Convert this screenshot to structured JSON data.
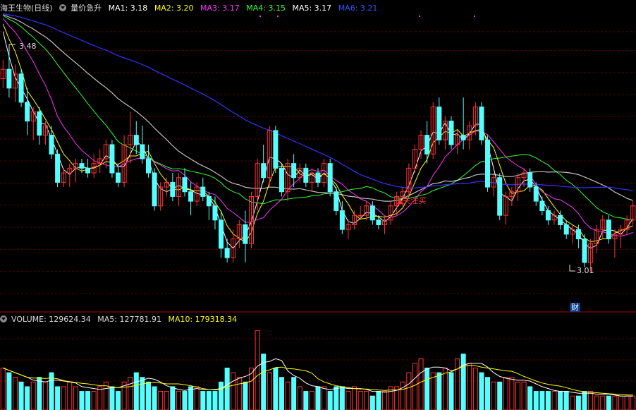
{
  "price_panel": {
    "stock_name": "海王生物(日线)",
    "indicator_name": "量价急升",
    "ma": [
      {
        "label": "MA1: 3.18",
        "color": "#ffffff"
      },
      {
        "label": "MA2: 3.20",
        "color": "#ffff00"
      },
      {
        "label": "MA3: 3.17",
        "color": "#ff33ff"
      },
      {
        "label": "MA4: 3.15",
        "color": "#33ff33"
      },
      {
        "label": "MA5: 3.17",
        "color": "#ffffff"
      },
      {
        "label": "MA6: 3.21",
        "color": "#3333ff"
      }
    ],
    "high_label": "3.48",
    "low_label": "3.01",
    "signal_text": "▲关注买",
    "finance_badge": "财"
  },
  "volume_panel": {
    "title": "VOLUME: 129624.34",
    "ma5": "MA5: 127781.91",
    "ma10": "MA10: 179318.34"
  },
  "chart_data": {
    "type": "candlestick",
    "up_color": "#ff3232",
    "down_color": "#54ffff",
    "price_range": [
      2.94,
      3.56
    ],
    "candles": [
      [
        3.42,
        3.46,
        3.4,
        3.44
      ],
      [
        3.44,
        3.48,
        3.38,
        3.4
      ],
      [
        3.4,
        3.45,
        3.37,
        3.43
      ],
      [
        3.43,
        3.44,
        3.36,
        3.37
      ],
      [
        3.37,
        3.4,
        3.3,
        3.33
      ],
      [
        3.33,
        3.36,
        3.29,
        3.35
      ],
      [
        3.35,
        3.36,
        3.28,
        3.3
      ],
      [
        3.3,
        3.33,
        3.28,
        3.32
      ],
      [
        3.3,
        3.32,
        3.25,
        3.26
      ],
      [
        3.26,
        3.27,
        3.19,
        3.2
      ],
      [
        3.2,
        3.23,
        3.19,
        3.22
      ],
      [
        3.22,
        3.24,
        3.19,
        3.23
      ],
      [
        3.23,
        3.25,
        3.2,
        3.24
      ],
      [
        3.24,
        3.25,
        3.22,
        3.23
      ],
      [
        3.23,
        3.25,
        3.21,
        3.22
      ],
      [
        3.22,
        3.26,
        3.21,
        3.24
      ],
      [
        3.24,
        3.27,
        3.22,
        3.25
      ],
      [
        3.25,
        3.29,
        3.23,
        3.28
      ],
      [
        3.28,
        3.29,
        3.21,
        3.22
      ],
      [
        3.22,
        3.24,
        3.19,
        3.2
      ],
      [
        3.2,
        3.3,
        3.19,
        3.28
      ],
      [
        3.28,
        3.35,
        3.24,
        3.3
      ],
      [
        3.3,
        3.33,
        3.26,
        3.28
      ],
      [
        3.28,
        3.32,
        3.24,
        3.25
      ],
      [
        3.25,
        3.28,
        3.21,
        3.22
      ],
      [
        3.22,
        3.23,
        3.14,
        3.15
      ],
      [
        3.15,
        3.2,
        3.14,
        3.19
      ],
      [
        3.19,
        3.21,
        3.17,
        3.2
      ],
      [
        3.2,
        3.22,
        3.16,
        3.17
      ],
      [
        3.17,
        3.22,
        3.15,
        3.21
      ],
      [
        3.21,
        3.23,
        3.17,
        3.18
      ],
      [
        3.18,
        3.2,
        3.13,
        3.16
      ],
      [
        3.16,
        3.2,
        3.15,
        3.19
      ],
      [
        3.19,
        3.21,
        3.16,
        3.17
      ],
      [
        3.17,
        3.18,
        3.12,
        3.15
      ],
      [
        3.15,
        3.17,
        3.1,
        3.12
      ],
      [
        3.12,
        3.14,
        3.04,
        3.06
      ],
      [
        3.06,
        3.08,
        3.03,
        3.04
      ],
      [
        3.04,
        3.1,
        3.03,
        3.08
      ],
      [
        3.08,
        3.12,
        3.06,
        3.11
      ],
      [
        3.11,
        3.14,
        3.03,
        3.07
      ],
      [
        3.07,
        3.18,
        3.06,
        3.17
      ],
      [
        3.17,
        3.25,
        3.14,
        3.24
      ],
      [
        3.24,
        3.28,
        3.2,
        3.21
      ],
      [
        3.21,
        3.32,
        3.19,
        3.31
      ],
      [
        3.31,
        3.32,
        3.22,
        3.23
      ],
      [
        3.23,
        3.24,
        3.17,
        3.18
      ],
      [
        3.18,
        3.25,
        3.16,
        3.24
      ],
      [
        3.24,
        3.26,
        3.19,
        3.21
      ],
      [
        3.21,
        3.24,
        3.2,
        3.23
      ],
      [
        3.23,
        3.24,
        3.19,
        3.2
      ],
      [
        3.2,
        3.23,
        3.18,
        3.22
      ],
      [
        3.22,
        3.23,
        3.19,
        3.2
      ],
      [
        3.2,
        3.25,
        3.19,
        3.24
      ],
      [
        3.24,
        3.25,
        3.17,
        3.18
      ],
      [
        3.18,
        3.19,
        3.13,
        3.14
      ],
      [
        3.14,
        3.16,
        3.09,
        3.1
      ],
      [
        3.1,
        3.12,
        3.08,
        3.11
      ],
      [
        3.11,
        3.14,
        3.1,
        3.13
      ],
      [
        3.13,
        3.15,
        3.12,
        3.13
      ],
      [
        3.13,
        3.16,
        3.12,
        3.15
      ],
      [
        3.15,
        3.16,
        3.11,
        3.12
      ],
      [
        3.12,
        3.13,
        3.1,
        3.11
      ],
      [
        3.11,
        3.13,
        3.09,
        3.12
      ],
      [
        3.12,
        3.16,
        3.11,
        3.15
      ],
      [
        3.15,
        3.18,
        3.13,
        3.17
      ],
      [
        3.17,
        3.19,
        3.15,
        3.18
      ],
      [
        3.18,
        3.24,
        3.17,
        3.23
      ],
      [
        3.23,
        3.28,
        3.22,
        3.27
      ],
      [
        3.27,
        3.31,
        3.25,
        3.3
      ],
      [
        3.3,
        3.33,
        3.24,
        3.26
      ],
      [
        3.26,
        3.37,
        3.25,
        3.36
      ],
      [
        3.36,
        3.38,
        3.28,
        3.29
      ],
      [
        3.29,
        3.34,
        3.27,
        3.33
      ],
      [
        3.33,
        3.34,
        3.27,
        3.28
      ],
      [
        3.28,
        3.31,
        3.26,
        3.3
      ],
      [
        3.3,
        3.38,
        3.27,
        3.29
      ],
      [
        3.29,
        3.33,
        3.27,
        3.32
      ],
      [
        3.32,
        3.37,
        3.3,
        3.36
      ],
      [
        3.36,
        3.37,
        3.28,
        3.29
      ],
      [
        3.29,
        3.3,
        3.18,
        3.19
      ],
      [
        3.19,
        3.22,
        3.17,
        3.21
      ],
      [
        3.21,
        3.22,
        3.12,
        3.13
      ],
      [
        3.13,
        3.18,
        3.11,
        3.17
      ],
      [
        3.17,
        3.19,
        3.15,
        3.18
      ],
      [
        3.18,
        3.22,
        3.16,
        3.21
      ],
      [
        3.21,
        3.23,
        3.19,
        3.22
      ],
      [
        3.22,
        3.23,
        3.18,
        3.19
      ],
      [
        3.19,
        3.2,
        3.15,
        3.16
      ],
      [
        3.16,
        3.17,
        3.13,
        3.14
      ],
      [
        3.14,
        3.15,
        3.11,
        3.12
      ],
      [
        3.12,
        3.14,
        3.11,
        3.13
      ],
      [
        3.13,
        3.14,
        3.1,
        3.11
      ],
      [
        3.11,
        3.12,
        3.08,
        3.09
      ],
      [
        3.09,
        3.11,
        3.07,
        3.1
      ],
      [
        3.1,
        3.11,
        3.06,
        3.08
      ],
      [
        3.08,
        3.09,
        3.02,
        3.03
      ],
      [
        3.03,
        3.08,
        3.01,
        3.07
      ],
      [
        3.07,
        3.11,
        3.05,
        3.1
      ],
      [
        3.1,
        3.13,
        3.08,
        3.12
      ],
      [
        3.12,
        3.13,
        3.07,
        3.08
      ],
      [
        3.08,
        3.1,
        3.04,
        3.09
      ],
      [
        3.09,
        3.11,
        3.06,
        3.1
      ],
      [
        3.1,
        3.13,
        3.09,
        3.12
      ],
      [
        3.12,
        3.16,
        3.11,
        3.15
      ]
    ],
    "volumes": [
      9,
      8,
      7,
      6,
      5,
      6,
      7,
      6,
      8,
      5,
      5,
      6,
      5,
      4,
      4,
      4,
      5,
      6,
      5,
      4,
      6,
      7,
      8,
      7,
      6,
      5,
      4,
      4,
      5,
      4,
      4,
      5,
      5,
      4,
      4,
      4,
      6,
      9,
      8,
      7,
      6,
      9,
      17,
      12,
      8,
      9,
      7,
      6,
      7,
      5,
      4,
      4,
      5,
      5,
      4,
      5,
      5,
      4,
      5,
      4,
      4,
      3,
      4,
      4,
      5,
      5,
      6,
      8,
      10,
      11,
      9,
      8,
      8,
      9,
      8,
      11,
      12,
      10,
      9,
      8,
      7,
      6,
      6,
      7,
      7,
      6,
      6,
      5,
      4,
      4,
      4,
      4,
      4,
      4,
      3,
      3,
      4,
      4,
      3,
      3,
      3,
      3,
      3,
      3,
      3
    ]
  }
}
